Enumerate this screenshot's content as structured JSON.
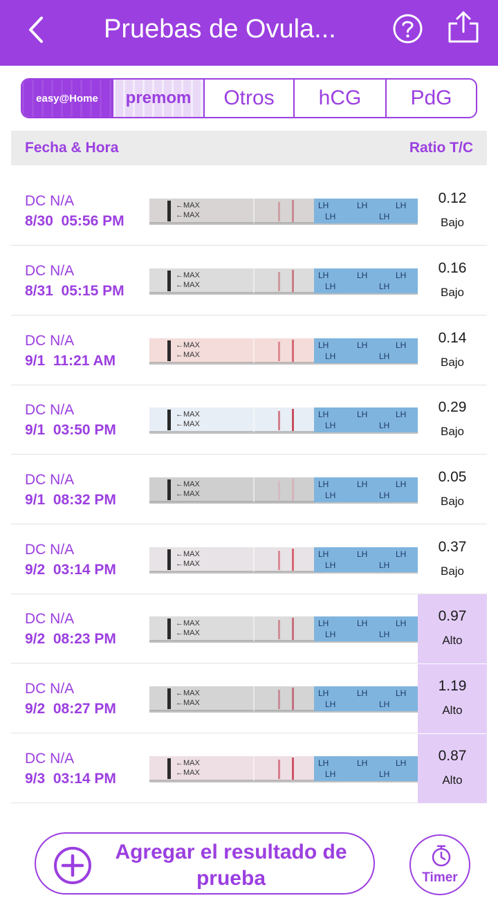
{
  "header": {
    "title": "Pruebas de Ovula...",
    "back_icon": "chevron-left-icon",
    "help_icon": "help-circle-icon",
    "share_icon": "share-icon"
  },
  "brands": {
    "easy_label": "easy@Home",
    "premom_label": "premom",
    "otros_label": "Otros",
    "hcg_label": "hCG",
    "pdg_label": "PdG",
    "active": "easy@Home"
  },
  "columns": {
    "left": "Fecha & Hora",
    "right": "Ratio T/C"
  },
  "rows": [
    {
      "dc": "DC N/A",
      "datetime": "8/30  05:56 PM",
      "ratio": "0.12",
      "level": "Bajo",
      "high": false
    },
    {
      "dc": "DC N/A",
      "datetime": "8/31  05:15 PM",
      "ratio": "0.16",
      "level": "Bajo",
      "high": false
    },
    {
      "dc": "DC N/A",
      "datetime": "9/1  11:21 AM",
      "ratio": "0.14",
      "level": "Bajo",
      "high": false
    },
    {
      "dc": "DC N/A",
      "datetime": "9/1  03:50 PM",
      "ratio": "0.29",
      "level": "Bajo",
      "high": false
    },
    {
      "dc": "DC N/A",
      "datetime": "9/1  08:32 PM",
      "ratio": "0.05",
      "level": "Bajo",
      "high": false
    },
    {
      "dc": "DC N/A",
      "datetime": "9/2  03:14 PM",
      "ratio": "0.37",
      "level": "Bajo",
      "high": false
    },
    {
      "dc": "DC N/A",
      "datetime": "9/2  08:23 PM",
      "ratio": "0.97",
      "level": "Alto",
      "high": true
    },
    {
      "dc": "DC N/A",
      "datetime": "9/2  08:27 PM",
      "ratio": "1.19",
      "level": "Alto",
      "high": true
    },
    {
      "dc": "DC N/A",
      "datetime": "9/3  03:14 PM",
      "ratio": "0.87",
      "level": "Alto",
      "high": true
    }
  ],
  "strip_text": {
    "max": "MAX",
    "lh": "LH"
  },
  "footer": {
    "add_label": "Agregar el resultado de prueba",
    "timer_label": "Timer",
    "add_icon": "plus-circle-icon",
    "timer_icon": "stopwatch-icon"
  },
  "colors": {
    "primary": "#9b3fe0",
    "high_bg": "#e3cdf7",
    "header_bg": "#ebebeb"
  }
}
